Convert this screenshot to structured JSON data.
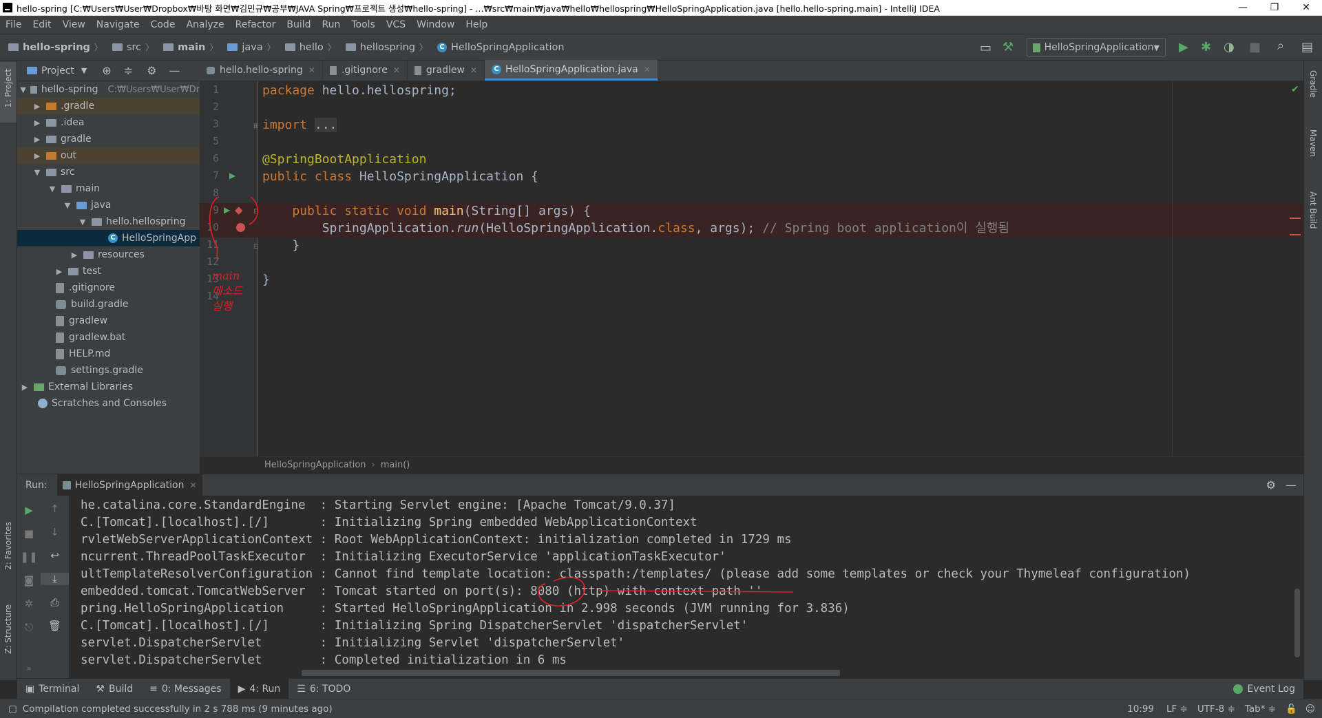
{
  "window": {
    "title": "hello-spring [C:₩Users₩User₩Dropbox₩바탕 화면₩김민규₩공부₩JAVA Spring₩프로젝트 생성₩hello-spring] - ...₩src₩main₩java₩hello₩hellospring₩HelloSpringApplication.java [hello.hello-spring.main] - IntelliJ IDEA",
    "minimize": "—",
    "restore": "❐",
    "close": "✕"
  },
  "menu": [
    "File",
    "Edit",
    "View",
    "Navigate",
    "Code",
    "Analyze",
    "Refactor",
    "Build",
    "Run",
    "Tools",
    "VCS",
    "Window",
    "Help"
  ],
  "breadcrumb": [
    "hello-spring",
    "src",
    "main",
    "java",
    "hello",
    "hellospring",
    "HelloSpringApplication"
  ],
  "run_config": "HelloSpringApplication",
  "left_strip": {
    "project": "1: Project",
    "favorites": "2: Favorites",
    "structure": "Z: Structure"
  },
  "right_strip": {
    "gradle": "Gradle",
    "maven": "Maven",
    "ant": "Ant Build"
  },
  "project_panel": {
    "title": "Project",
    "tree": [
      {
        "label": "hello-spring",
        "hint": "C:₩Users₩User₩Dr"
      },
      {
        "label": ".gradle"
      },
      {
        "label": ".idea"
      },
      {
        "label": "gradle"
      },
      {
        "label": "out"
      },
      {
        "label": "src"
      },
      {
        "label": "main"
      },
      {
        "label": "java"
      },
      {
        "label": "hello.hellospring"
      },
      {
        "label": "HelloSpringApp"
      },
      {
        "label": "resources"
      },
      {
        "label": "test"
      },
      {
        "label": ".gitignore"
      },
      {
        "label": "build.gradle"
      },
      {
        "label": "gradlew"
      },
      {
        "label": "gradlew.bat"
      },
      {
        "label": "HELP.md"
      },
      {
        "label": "settings.gradle"
      },
      {
        "label": "External Libraries"
      },
      {
        "label": "Scratches and Consoles"
      }
    ]
  },
  "tabs": [
    {
      "label": "hello.hello-spring"
    },
    {
      "label": ".gitignore"
    },
    {
      "label": "gradlew"
    },
    {
      "label": "HelloSpringApplication.java"
    }
  ],
  "editor": {
    "line_numbers": [
      "1",
      "2",
      "3",
      "5",
      "6",
      "7",
      "8",
      "9",
      "10",
      "11",
      "12",
      "13",
      "14"
    ],
    "code": {
      "l1_kw": "package ",
      "l1_rest": "hello.hellospring;",
      "l3_kw": "import ",
      "l3_rest": "...",
      "l6": "@SpringBootApplication",
      "l7_kw": "public class ",
      "l7_rest": "HelloSpringApplication {",
      "l9_kw": "    public static void ",
      "l9_fn": "main",
      "l9_rest": "(String[] args) {",
      "l10_a": "        SpringApplication.",
      "l10_run": "run",
      "l10_b": "(HelloSpringApplication.",
      "l10_cls": "class",
      "l10_c": ", args); ",
      "l10_cm": "// Spring boot application이 실행됨",
      "l11": "    }",
      "l13": "}"
    },
    "breadcrumb": [
      "HelloSpringApplication",
      "main()"
    ],
    "handwritten_note": [
      "main",
      "메소드",
      "실행"
    ]
  },
  "run": {
    "label": "Run:",
    "tab": "HelloSpringApplication",
    "console": [
      "he.catalina.core.StandardEngine  : Starting Servlet engine: [Apache Tomcat/9.0.37]",
      "C.[Tomcat].[localhost].[/]       : Initializing Spring embedded WebApplicationContext",
      "rvletWebServerApplicationContext : Root WebApplicationContext: initialization completed in 1729 ms",
      "ncurrent.ThreadPoolTaskExecutor  : Initializing ExecutorService 'applicationTaskExecutor'",
      "ultTemplateResolverConfiguration : Cannot find template location: classpath:/templates/ (please add some templates or check your Thymeleaf configuration)",
      "embedded.tomcat.TomcatWebServer  : Tomcat started on port(s): 8080 (http) with context path ''",
      "pring.HelloSpringApplication     : Started HelloSpringApplication in 2.998 seconds (JVM running for 3.836)",
      "C.[Tomcat].[localhost].[/]       : Initializing Spring DispatcherServlet 'dispatcherServlet'",
      "servlet.DispatcherServlet        : Initializing Servlet 'dispatcherServlet'",
      "servlet.DispatcherServlet        : Completed initialization in 6 ms"
    ]
  },
  "bottom_tools": [
    {
      "label": "Terminal"
    },
    {
      "label": "Build"
    },
    {
      "label": "0: Messages"
    },
    {
      "label": "4: Run"
    },
    {
      "label": "6: TODO"
    }
  ],
  "event_log": "Event Log",
  "status": {
    "message": "Compilation completed successfully in 2 s 788 ms (9 minutes ago)",
    "position": "10:99",
    "line_sep": "LF ≑",
    "encoding": "UTF-8 ≑",
    "indent": "Tab* ≑"
  },
  "colors": {
    "accent": "#4a88c7",
    "keyword": "#cc7832",
    "annotation": "#bbb529",
    "function": "#ffc66d",
    "comment": "#808080",
    "breakpoint": "#c75450",
    "run_green": "#59a869",
    "handwriting": "#e0202a"
  }
}
